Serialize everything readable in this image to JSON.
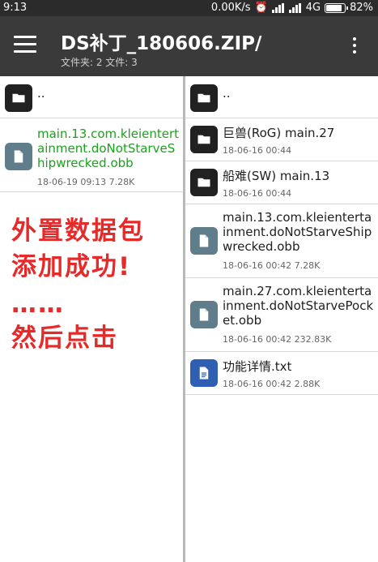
{
  "status_bar": {
    "time": "9:13",
    "speed": "0.00K/s",
    "network": "4G",
    "battery": "82%"
  },
  "app_bar": {
    "title": "DS补丁_180606.ZIP/",
    "subtitle": "文件夹: 2  文件: 3"
  },
  "left_pane": {
    "items": [
      {
        "type": "folder",
        "name": ".."
      },
      {
        "type": "file",
        "name": "main.13.com.kleientertainment.doNotStarveShipwrecked.obb",
        "meta": "18-06-19 09:13  7.28K"
      }
    ]
  },
  "right_pane": {
    "items": [
      {
        "type": "folder",
        "name": ".."
      },
      {
        "type": "folder",
        "name": "巨兽(RoG) main.27",
        "meta": "18-06-16 00:44"
      },
      {
        "type": "folder",
        "name": "船难(SW) main.13",
        "meta": "18-06-16 00:44"
      },
      {
        "type": "file",
        "name": "main.13.com.kleientertainment.doNotStarveShipwrecked.obb",
        "meta": "18-06-16 00:42  7.28K"
      },
      {
        "type": "file",
        "name": "main.27.com.kleientertainment.doNotStarvePocket.obb",
        "meta": "18-06-16 00:42  232.83K"
      },
      {
        "type": "txt",
        "name": "功能详情.txt",
        "meta": "18-06-16 00:42  2.88K"
      }
    ]
  },
  "annotation": {
    "line1": "外置数据包",
    "line2": "添加成功!",
    "line3": "……",
    "line4": "然后点击"
  },
  "colors": {
    "accent_green": "#1aa31a",
    "annotation_red": "#e62a2a",
    "appbar": "#3a3a3a"
  }
}
